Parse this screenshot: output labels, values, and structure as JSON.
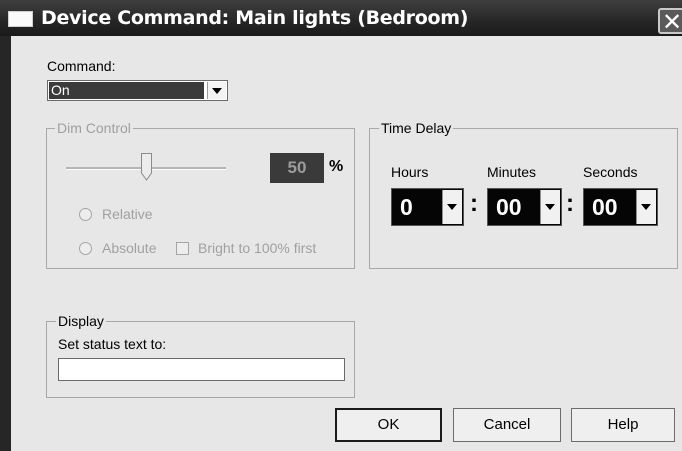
{
  "window": {
    "title": "Device Command: Main lights (Bedroom)",
    "close_glyph": "✕"
  },
  "command": {
    "label": "Command:",
    "selected": "On"
  },
  "dim_control": {
    "label": "Dim Control",
    "level_fraction": 0.5,
    "value": "50",
    "unit": "%",
    "relative_label": "Relative",
    "absolute_label": "Absolute",
    "bright_label": "Bright to 100% first",
    "enabled": false
  },
  "time_delay": {
    "label": "Time Delay",
    "hours_label": "Hours",
    "minutes_label": "Minutes",
    "seconds_label": "Seconds",
    "hours": "0",
    "minutes": "00",
    "seconds": "00",
    "separator": ":"
  },
  "display": {
    "label": "Display",
    "field_label": "Set status text to:",
    "value": ""
  },
  "buttons": {
    "ok": "OK",
    "cancel": "Cancel",
    "help": "Help"
  },
  "colors": {
    "window_bg": "#e7e7e7",
    "titlebar": "#262626",
    "time_box_bg": "#050505",
    "disabled_text": "#a0a0a0"
  }
}
